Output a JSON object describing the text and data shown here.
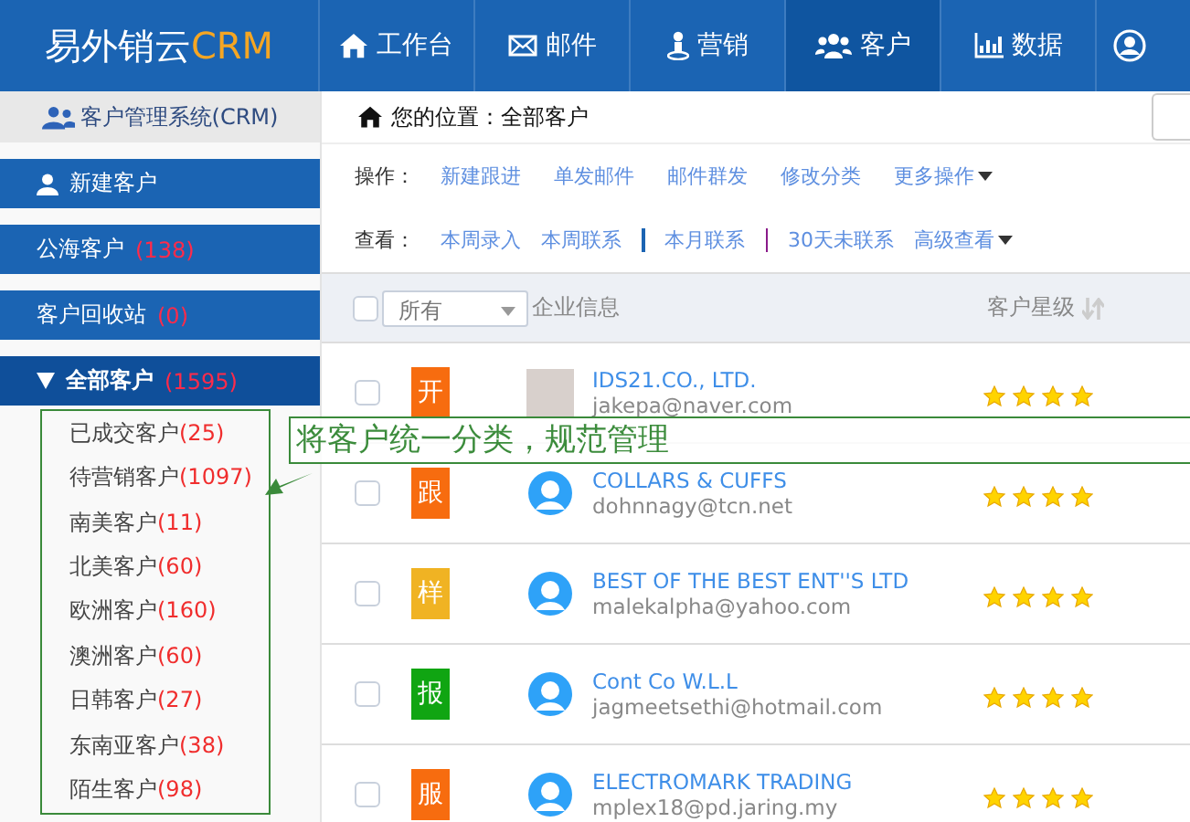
{
  "logo": {
    "text": "易外销云",
    "accent": "CRM"
  },
  "nav": [
    {
      "kind": "home",
      "label": "工作台",
      "selected": false
    },
    {
      "kind": "mail",
      "label": "邮件",
      "selected": false
    },
    {
      "kind": "marketing",
      "label": "营销",
      "selected": false
    },
    {
      "kind": "customers",
      "label": "客户",
      "selected": true
    },
    {
      "kind": "data",
      "label": "数据",
      "selected": false
    },
    {
      "kind": "account",
      "selected": false
    }
  ],
  "sidebar": {
    "title": "客户管理系统(CRM)",
    "items": [
      {
        "kind": "action",
        "label": "新建客户"
      },
      {
        "kind": "link",
        "label": "公海客户",
        "count": "(138)"
      },
      {
        "kind": "link",
        "label": "客户回收站",
        "count": "(0)"
      },
      {
        "kind": "group",
        "label": "全部客户",
        "count": "(1595)",
        "expanded": true,
        "children": [
          {
            "label": "已成交客户",
            "count": "(25)"
          },
          {
            "label": "待营销客户",
            "count": "(1097)"
          },
          {
            "label": "南美客户",
            "count": "(11)"
          },
          {
            "label": "北美客户",
            "count": "(60)"
          },
          {
            "label": "欧洲客户",
            "count": "(160)"
          },
          {
            "label": "澳洲客户",
            "count": "(60)"
          },
          {
            "label": "日韩客户",
            "count": "(27)"
          },
          {
            "label": "东南亚客户",
            "count": "(38)"
          },
          {
            "label": "陌生客户",
            "count": "(98)"
          }
        ]
      }
    ]
  },
  "breadcrumb": "您的位置：全部客户",
  "actions": {
    "label": "操作：",
    "items": [
      "新建跟进",
      "单发邮件",
      "邮件群发",
      "修改分类"
    ],
    "more": "更多操作"
  },
  "views": {
    "label": "查看：",
    "items": [
      "本周录入",
      "本周联系",
      "本月联系",
      "30天未联系"
    ],
    "more": "高级查看"
  },
  "table": {
    "all_checked": false,
    "filter": "所有",
    "columns": [
      "企业信息",
      "客户星级"
    ],
    "rows": [
      {
        "checked": false,
        "tag": "开",
        "color": "#f76c0f",
        "kind": "photo",
        "company": "IDS21.CO., LTD.",
        "email": "jakepa@naver.com",
        "stars": 4
      },
      {
        "checked": false,
        "tag": "跟",
        "color": "#f76c0f",
        "kind": "default",
        "company": "COLLARS & CUFFS",
        "email": "dohnnagy@tcn.net",
        "stars": 4
      },
      {
        "checked": false,
        "tag": "样",
        "color": "#f0b323",
        "kind": "default",
        "company": "BEST OF THE BEST ENT''S LTD",
        "email": "malekalpha@yahoo.com",
        "stars": 4
      },
      {
        "checked": false,
        "tag": "报",
        "color": "#10a512",
        "kind": "default",
        "company": "Cont Co W.L.L",
        "email": "jagmeetsethi@hotmail.com",
        "stars": 4
      },
      {
        "checked": false,
        "tag": "服",
        "color": "#f76c0f",
        "kind": "default",
        "company": "ELECTROMARK TRADING",
        "email": "mplex18@pd.jaring.my",
        "stars": 4
      }
    ]
  },
  "annotation": {
    "text": "将客户统一分类，规范管理"
  }
}
